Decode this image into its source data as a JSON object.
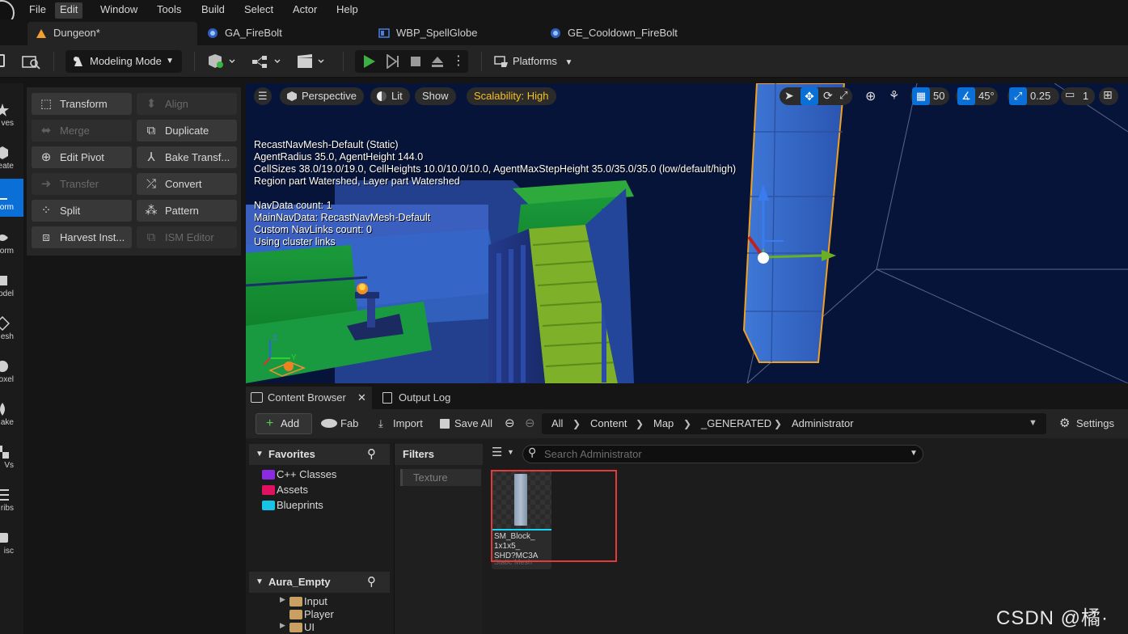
{
  "menu": [
    "File",
    "Edit",
    "Window",
    "Tools",
    "Build",
    "Select",
    "Actor",
    "Help"
  ],
  "tabs": [
    {
      "label": "Dungeon*",
      "active": true,
      "icon": "level-icon"
    },
    {
      "label": "GA_FireBolt",
      "icon": "blueprint-icon"
    },
    {
      "label": "WBP_SpellGlobe",
      "icon": "widget-blueprint-icon"
    },
    {
      "label": "GE_Cooldown_FireBolt",
      "icon": "blueprint-icon"
    }
  ],
  "toolbar": {
    "mode": "Modeling Mode",
    "platforms": "Platforms"
  },
  "strip": [
    "ves",
    "eate",
    "orm",
    "form",
    "odel",
    "esh",
    "oxel",
    "ake",
    "Vs",
    "ribs",
    "isc"
  ],
  "modeling": {
    "buttons": [
      {
        "label": "Transform",
        "enabled": true,
        "icon": "transform-icon"
      },
      {
        "label": "Align",
        "enabled": false,
        "icon": "align-icon"
      },
      {
        "label": "Merge",
        "enabled": false,
        "icon": "merge-icon"
      },
      {
        "label": "Duplicate",
        "enabled": true,
        "icon": "duplicate-icon"
      },
      {
        "label": "Edit Pivot",
        "enabled": true,
        "icon": "pivot-icon"
      },
      {
        "label": "Bake Transf...",
        "enabled": true,
        "icon": "bake-transform-icon"
      },
      {
        "label": "Transfer",
        "enabled": false,
        "icon": "transfer-icon"
      },
      {
        "label": "Convert",
        "enabled": true,
        "icon": "convert-icon"
      },
      {
        "label": "Split",
        "enabled": true,
        "icon": "split-icon"
      },
      {
        "label": "Pattern",
        "enabled": true,
        "icon": "pattern-icon"
      },
      {
        "label": "Harvest Inst...",
        "enabled": true,
        "icon": "harvest-icon"
      },
      {
        "label": "ISM Editor",
        "enabled": false,
        "icon": "ism-editor-icon"
      }
    ]
  },
  "viewport": {
    "perspective": "Perspective",
    "lit": "Lit",
    "show": "Show",
    "scalability": "Scalability: High",
    "grid_snap": "50",
    "rot_snap": "45°",
    "scale_snap": "0.25",
    "camera_speed": "1",
    "nav_info": "RecastNavMesh-Default (Static)\nAgentRadius 35.0, AgentHeight 144.0\nCellSizes 38.0/19.0/19.0, CellHeights 10.0/10.0/10.0, AgentMaxStepHeight 35.0/35.0/35.0 (low/default/high)\nRegion part Watershed, Layer part Watershed\n\nNavData count: 1\nMainNavData: RecastNavMesh-Default\nCustom NavLinks count: 0\nUsing cluster links",
    "axis_y": "Y",
    "axis_z": "Z"
  },
  "content_browser": {
    "tab": "Content Browser",
    "output_tab": "Output Log",
    "add": "Add",
    "fab": "Fab",
    "import": "Import",
    "save_all": "Save All",
    "settings": "Settings",
    "path": [
      "All",
      "Content",
      "Map",
      "_GENERATED",
      "Administrator"
    ],
    "favorites": "Favorites",
    "fav_items": [
      {
        "label": "C++ Classes",
        "color": "#8a2be2"
      },
      {
        "label": "Assets",
        "color": "#e0115f"
      },
      {
        "label": "Blueprints",
        "color": "#19c3e6"
      }
    ],
    "project": "Aura_Empty",
    "project_items": [
      "Input",
      "Player",
      "UI"
    ],
    "filters": "Filters",
    "filter_chip": "Texture",
    "search_placeholder": "Search Administrator",
    "asset": {
      "name": "SM_Block_\n1x1x5_\nSHD?MC3A",
      "type": "Static Mesh"
    }
  },
  "watermark": "CSDN @橘·灬"
}
